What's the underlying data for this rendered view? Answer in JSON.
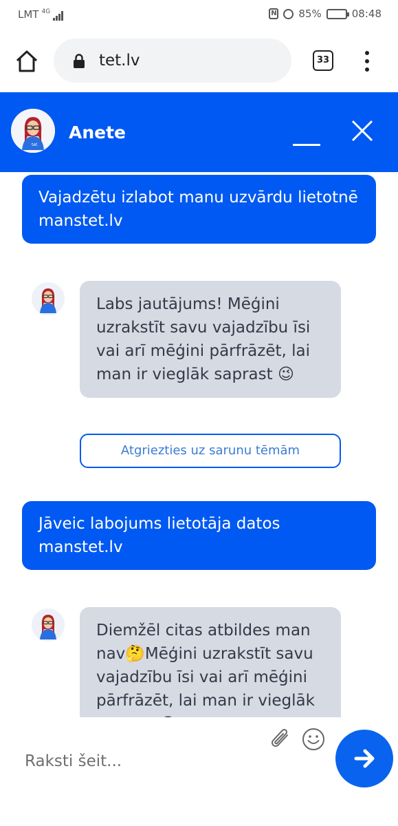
{
  "status_bar": {
    "carrier": "LMT",
    "network": "4G",
    "battery": "85%",
    "battery_level": 0.85,
    "time": "08:48"
  },
  "browser": {
    "url": "tet.lv",
    "tab_count": "33"
  },
  "chat": {
    "agent_name": "Anete",
    "avatar_badge": "tet",
    "messages": [
      {
        "role": "user",
        "text": "Vajadzētu izlabot manu uzvārdu lietotnē manstet.lv"
      },
      {
        "role": "bot",
        "text": "Labs jautājums! Mēģini uzrakstīt savu vajadzību īsi vai arī mēģini pārfrāzēt, lai man ir vieglāk saprast 😉"
      },
      {
        "role": "user",
        "text": "Jāveic labojums lietotāja datos manstet.lv"
      },
      {
        "role": "bot",
        "text": "Diemžēl citas atbildes man nav🤔Mēģini uzrakstīt savu vajadzību īsi vai arī mēģini pārfrāzēt, lai man ir vieglāk saprast 😉"
      }
    ],
    "back_to_topics_label": "Atgriezties uz sarunu tēmām"
  },
  "input": {
    "placeholder": "Raksti šeit..."
  },
  "icons": {
    "home": "home-icon",
    "lock": "lock-icon",
    "tabs": "tabs-icon",
    "menu": "more-vert-icon",
    "minimize": "minimize-icon",
    "close": "close-icon",
    "attach": "paperclip-icon",
    "emoji": "smiley-icon",
    "send": "arrow-right-icon"
  },
  "colors": {
    "brand_blue": "#0059f2",
    "bot_bubble": "#d6dae3",
    "send_button": "#0a63ef"
  }
}
